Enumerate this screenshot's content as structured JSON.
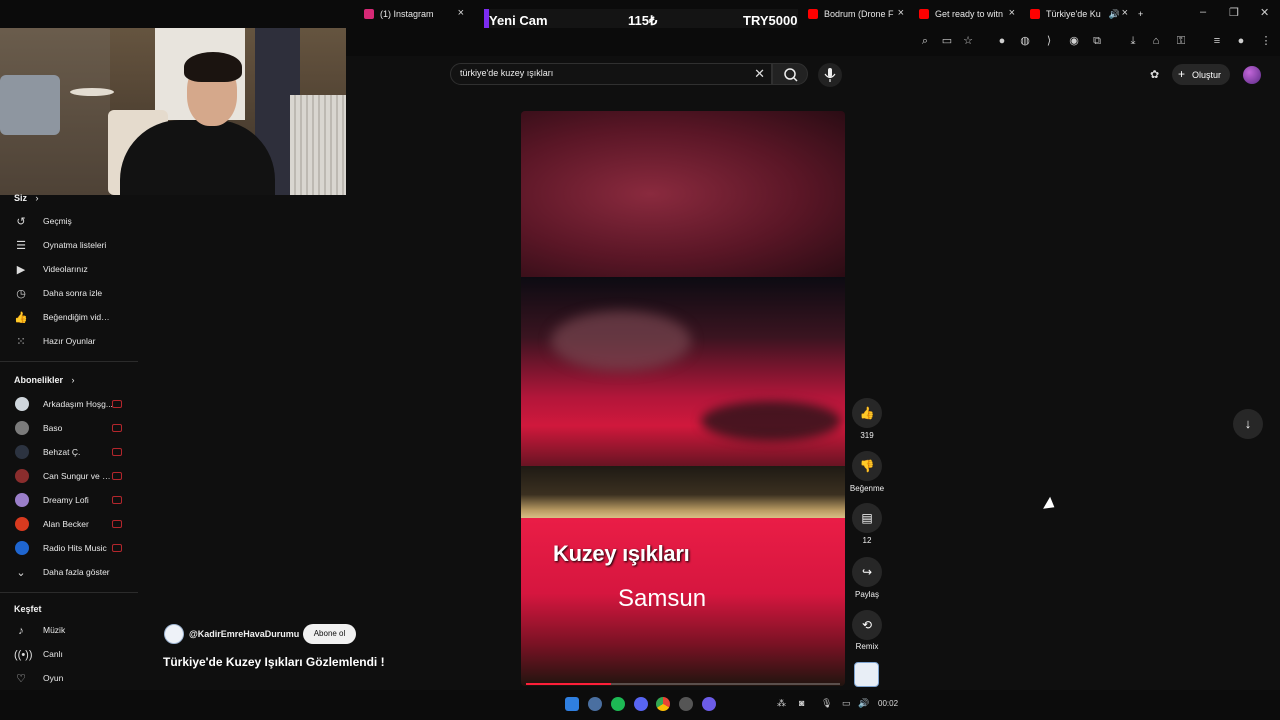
{
  "browser": {
    "tabs": [
      {
        "label": "(1) Instagram",
        "color": "#d62976"
      },
      {
        "label": "Bodrum (Drone F",
        "color": "#ff0000"
      },
      {
        "label": "Get ready to witn",
        "color": "#ff0000"
      },
      {
        "label": "Türkiye'de Ku",
        "color": "#ff0000"
      }
    ],
    "new_tab": "+"
  },
  "stream_overlay": {
    "left": "Yeni Cam",
    "middle": "115₺",
    "right": "TRY5000",
    "accent": "#7b2cf0"
  },
  "search": {
    "query": "türkiye'de kuzey ışıkları",
    "clear_icon": "✕"
  },
  "header": {
    "create_label": "Oluştur"
  },
  "sidebar": {
    "you_header": "Siz",
    "you_items": [
      {
        "label": "Geçmiş",
        "icon": "history-icon"
      },
      {
        "label": "Oynatma listeleri",
        "icon": "playlist-icon"
      },
      {
        "label": "Videolarınız",
        "icon": "your-videos-icon"
      },
      {
        "label": "Daha sonra izle",
        "icon": "watch-later-icon"
      },
      {
        "label": "Beğendiğim videolar",
        "icon": "liked-icon"
      },
      {
        "label": "Hazır Oyunlar",
        "icon": "games-icon"
      }
    ],
    "subs_header": "Abonelikler",
    "subscriptions": [
      {
        "label": "Arkadaşım Hoşg...",
        "color": "#cfd6dc"
      },
      {
        "label": "Baso",
        "color": "#7b7b7b"
      },
      {
        "label": "Behzat Ç.",
        "color": "#2c3340"
      },
      {
        "label": "Can Sungur ve M...",
        "color": "#8a2d2d"
      },
      {
        "label": "Dreamy Lofi",
        "color": "#9a7ec9"
      },
      {
        "label": "Alan Becker",
        "color": "#d83a1f"
      },
      {
        "label": "Radio Hits Music",
        "color": "#1f66d0"
      }
    ],
    "show_more": "Daha fazla göster",
    "explore_header": "Keşfet",
    "explore_items": [
      {
        "label": "Müzik",
        "icon": "music-icon"
      },
      {
        "label": "Canlı",
        "icon": "live-icon"
      },
      {
        "label": "Oyun",
        "icon": "gaming-icon"
      }
    ]
  },
  "video": {
    "overlay_title": "Kuzey ışıkları",
    "overlay_subtitle": "Samsun",
    "progress": 0.27,
    "channel": "@KadirEmreHavaDurumu",
    "subscribe_label": "Abone ol",
    "title": "Türkiye'de Kuzey Işıkları Gözlemlendi !"
  },
  "actions": {
    "like_count": "319",
    "dislike_label": "Beğenme",
    "comment_count": "12",
    "share_label": "Paylaş",
    "remix_label": "Remix"
  },
  "taskbar": {
    "time": "00:02"
  }
}
